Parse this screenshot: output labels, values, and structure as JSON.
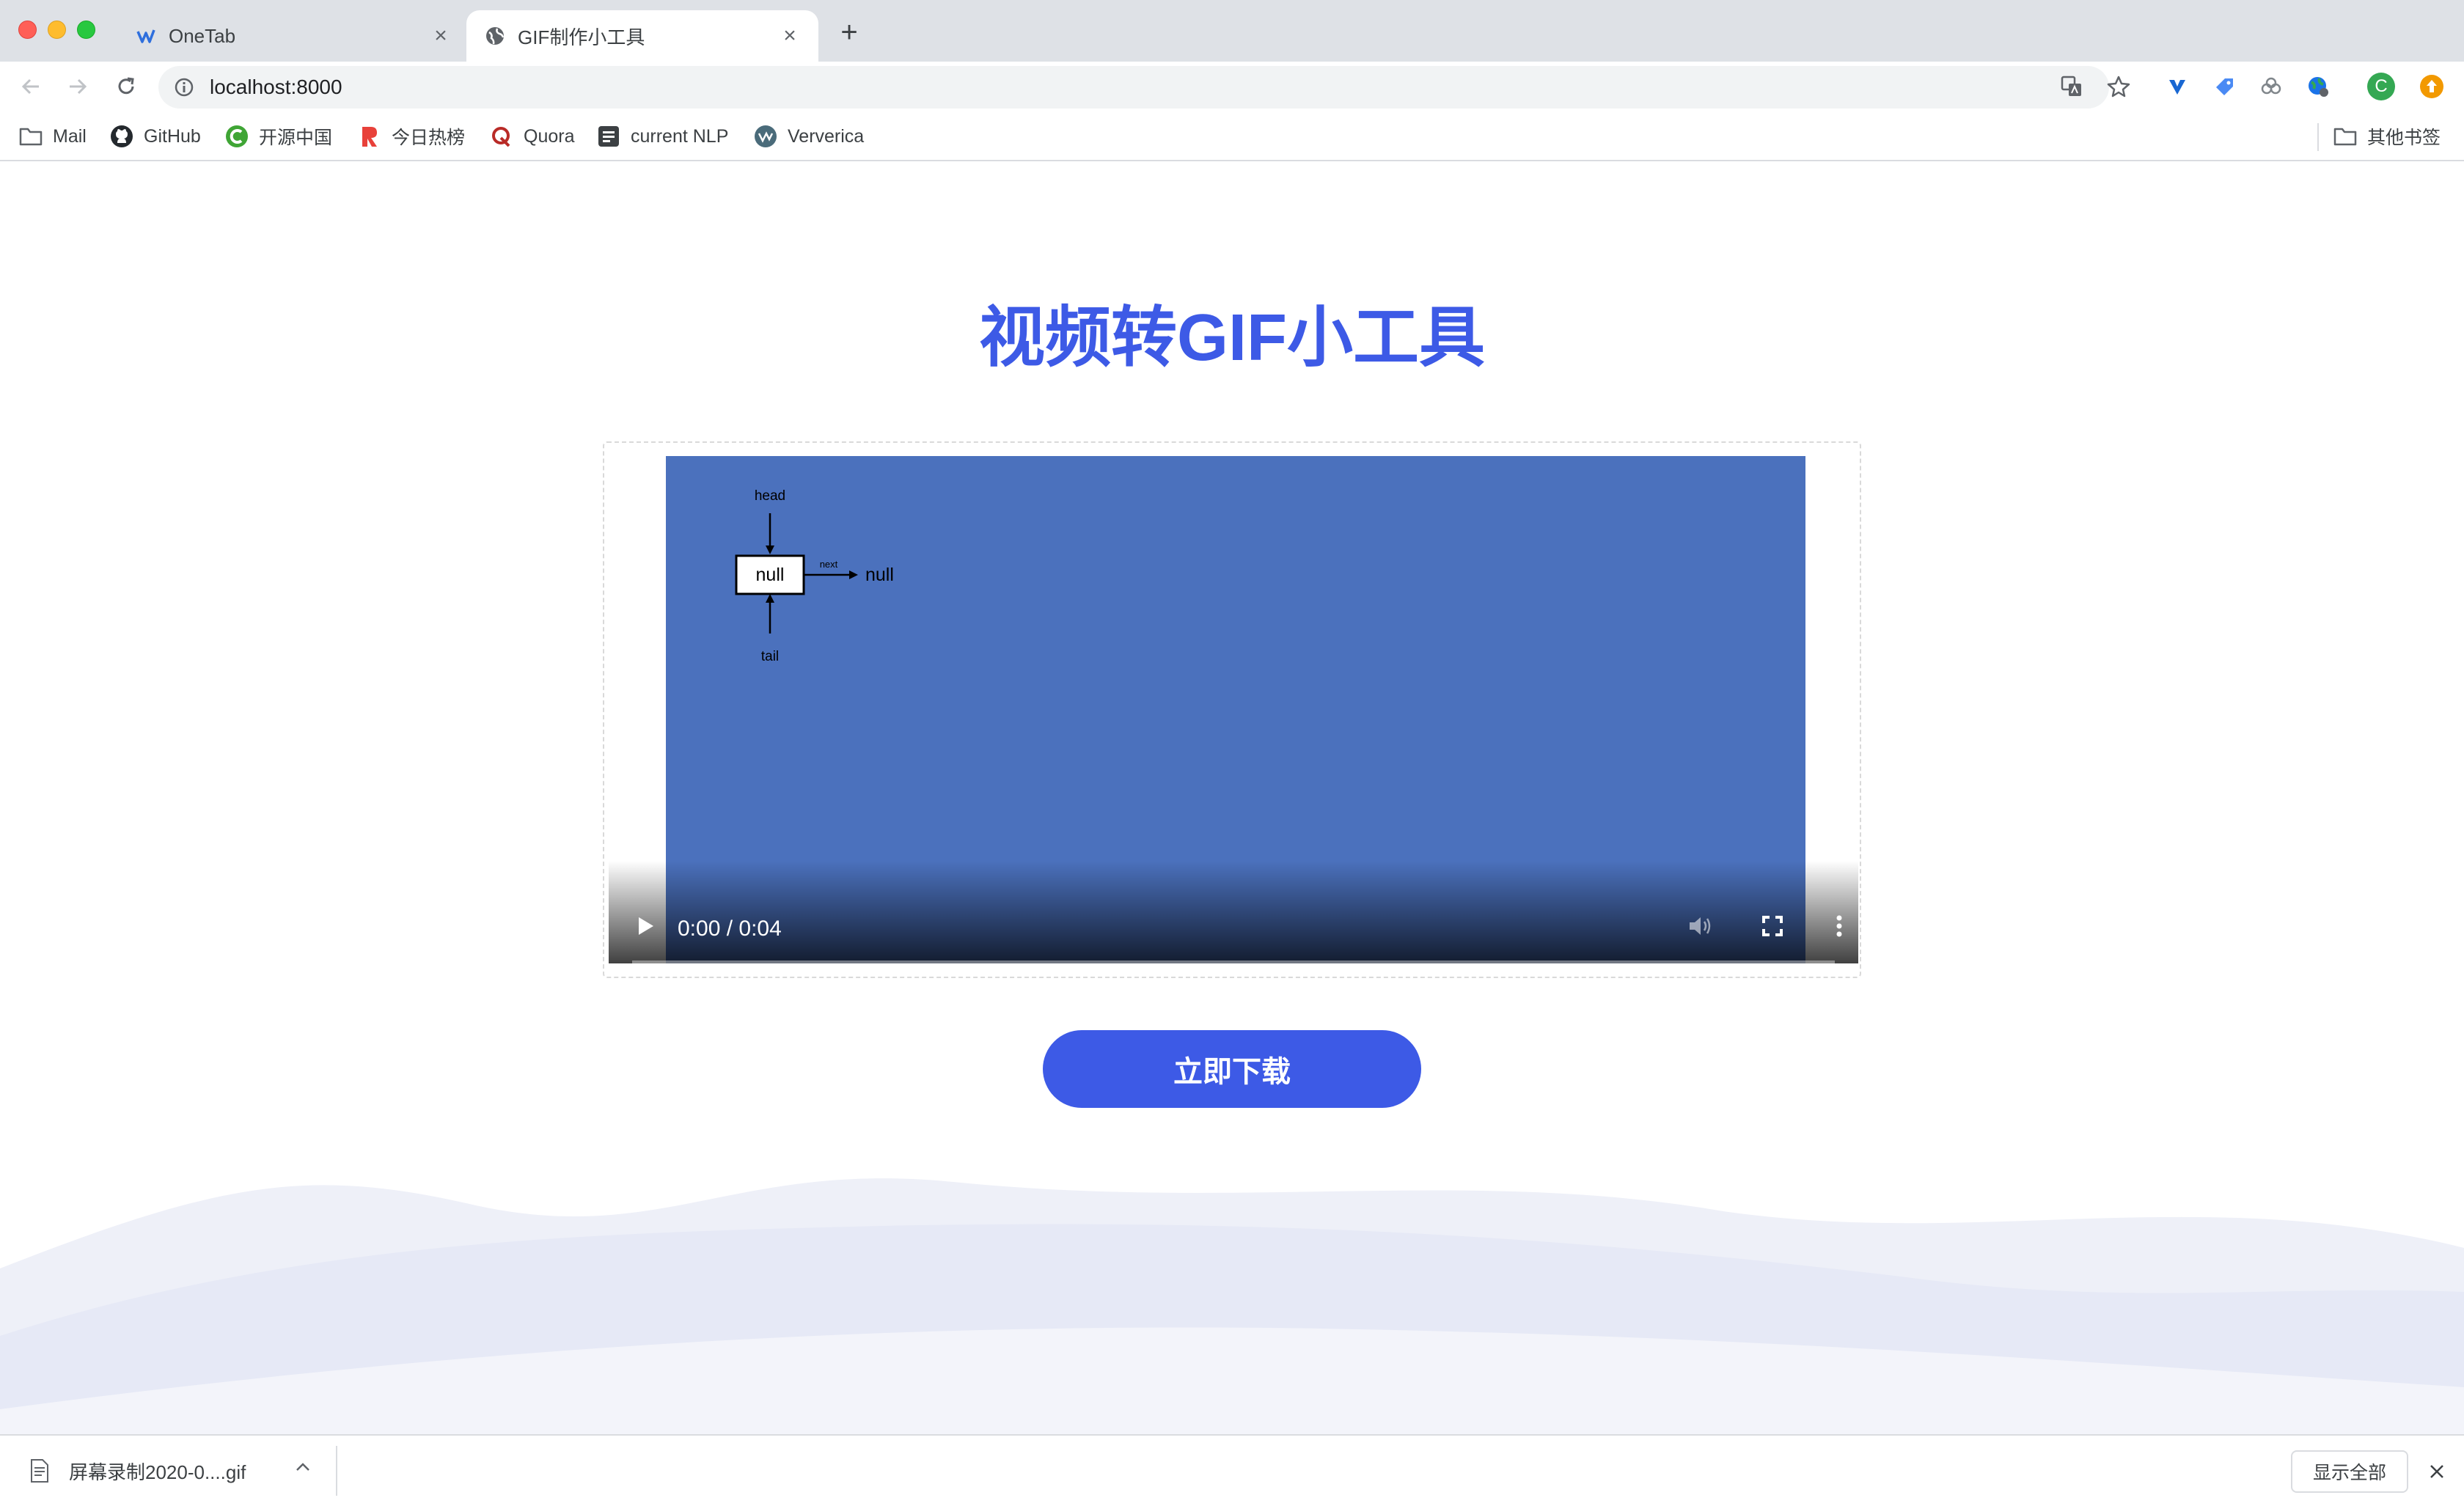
{
  "browser": {
    "tabs": [
      {
        "title": "OneTab",
        "favicon": "onetab-icon"
      },
      {
        "title": "GIF制作小工具",
        "favicon": "globe-icon"
      }
    ],
    "url": "localhost:8000",
    "bookmarks": [
      {
        "label": "Mail",
        "icon": "folder-icon"
      },
      {
        "label": "GitHub",
        "icon": "github-icon"
      },
      {
        "label": "开源中国",
        "icon": "oschina-icon"
      },
      {
        "label": "今日热榜",
        "icon": "tophub-icon"
      },
      {
        "label": "Quora",
        "icon": "quora-icon"
      },
      {
        "label": "current NLP",
        "icon": "list-icon"
      },
      {
        "label": "Ververica",
        "icon": "ververica-icon"
      }
    ],
    "other_bookmarks": "其他书签",
    "profile_initial": "C"
  },
  "page": {
    "title": "视频转GIF小工具",
    "video": {
      "time": "0:00 / 0:04",
      "diagram": {
        "head": "head",
        "node": "null",
        "next": "next",
        "target": "null",
        "tail": "tail"
      }
    },
    "download_button": "立即下载"
  },
  "download_bar": {
    "file": "屏幕录制2020-0....gif",
    "show_all": "显示全部"
  },
  "colors": {
    "accent": "#3d5ae6",
    "video_bg": "#4b71bd"
  }
}
